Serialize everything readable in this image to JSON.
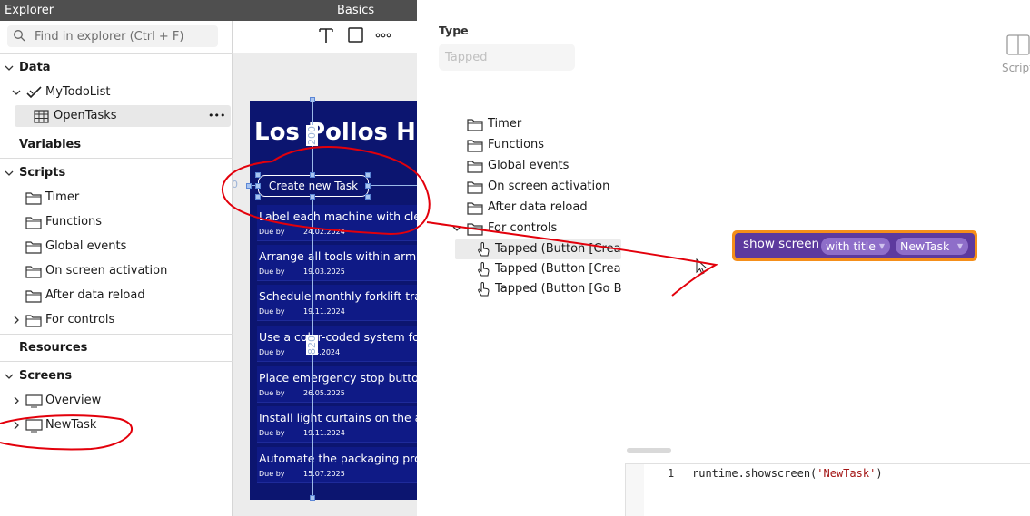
{
  "titlebar": {
    "explorer": "Explorer",
    "basics": "Basics"
  },
  "search": {
    "placeholder": "Find in explorer (Ctrl + F)"
  },
  "toolbar": {
    "text_icon": "text-icon",
    "box_icon": "box-icon",
    "more_icon": "more-icon"
  },
  "tree": {
    "data": "Data",
    "mytodolist": "MyTodoList",
    "opentasks": "OpenTasks",
    "opentasks_more": "•••",
    "variables": "Variables",
    "scripts": "Scripts",
    "script_items": [
      "Timer",
      "Functions",
      "Global events",
      "On screen activation",
      "After data reload",
      "For controls"
    ],
    "resources": "Resources",
    "screens": "Screens",
    "screen_items": [
      "Overview",
      "NewTask"
    ]
  },
  "canvas": {
    "title": "Los Pollos He",
    "create_button": "Create new Task",
    "dim_top": "200",
    "dim_left": "0",
    "dim_height": "820",
    "tasks": [
      {
        "title": "Label each machine with clear",
        "due_label": "Due by",
        "due": "24.02.2024"
      },
      {
        "title": "Arrange all tools within arm's r",
        "due_label": "Due by",
        "due": "19.03.2025"
      },
      {
        "title": "Schedule monthly forklift train",
        "due_label": "Due by",
        "due": "19.11.2024"
      },
      {
        "title": "Use a color-coded system for t",
        "due_label": "Due by",
        "due": "04.2024"
      },
      {
        "title": "Place emergency stop buttons",
        "due_label": "Due by",
        "due": "26.05.2025"
      },
      {
        "title": "Install light curtains on the ass",
        "due_label": "Due by",
        "due": "19.11.2024"
      },
      {
        "title": "Automate the packaging proce",
        "due_label": "Due by",
        "due": "15.07.2025"
      }
    ]
  },
  "type_panel": {
    "label": "Type",
    "value": "Tapped"
  },
  "scripts_tab": {
    "label": "Scripts"
  },
  "events_tree": {
    "folders": [
      "Timer",
      "Functions",
      "Global events",
      "On screen activation",
      "After data reload",
      "For controls"
    ],
    "handlers": [
      "Tapped (Button [Create",
      "Tapped (Button [Create",
      "Tapped (Button [Go Bacl"
    ]
  },
  "block": {
    "keyword": "show screen",
    "param": "with title",
    "value": "NewTask"
  },
  "editor": {
    "line_number": "1",
    "code_prefix": "runtime.showscreen(",
    "code_string": "'NewTask'",
    "code_suffix": ")"
  },
  "colors": {
    "phone_bg": "#0c1570",
    "block_border": "#f58f1a",
    "block_bg": "#5d3a9e",
    "annotation": "#e3000b"
  }
}
